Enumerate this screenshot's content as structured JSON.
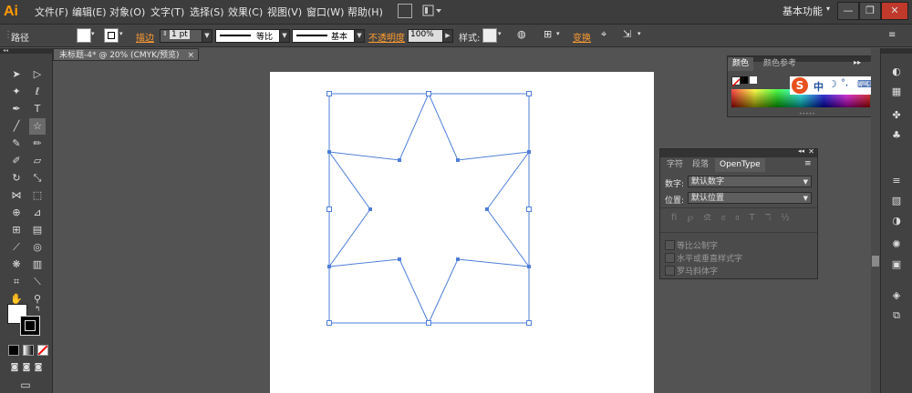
{
  "app": {
    "logo": "Ai",
    "workspace": "基本功能"
  },
  "menu": [
    {
      "label": "文件(F)"
    },
    {
      "label": "编辑(E)"
    },
    {
      "label": "对象(O)"
    },
    {
      "label": "文字(T)"
    },
    {
      "label": "选择(S)"
    },
    {
      "label": "效果(C)"
    },
    {
      "label": "视图(V)"
    },
    {
      "label": "窗口(W)"
    },
    {
      "label": "帮助(H)"
    }
  ],
  "window_buttons": {
    "minimize": "—",
    "restore": "❐",
    "close": "✕"
  },
  "control": {
    "path_label": "路径",
    "stroke_label": "描边",
    "stroke_weight": "1 pt",
    "profile_uniform": "等比",
    "brush_basic": "基本",
    "opacity_label": "不透明度",
    "opacity_value": "100%",
    "style_label": "样式:",
    "transform_label": "变换"
  },
  "document_tab": {
    "title": "未标题-4* @ 20% (CMYK/预览)",
    "close": "×"
  },
  "color_panel": {
    "tab_color": "颜色",
    "tab_guide": "颜色参考"
  },
  "char_panel": {
    "tab_char": "字符",
    "tab_para": "段落",
    "tab_opentype": "OpenType",
    "figure_label": "数字:",
    "figure_value": "默认数字",
    "position_label": "位置:",
    "position_value": "默认位置",
    "opt1": "等比公制字",
    "opt2": "水平或垂直样式字",
    "opt3": "罗马斜体字"
  },
  "ime": {
    "lang": "中"
  }
}
